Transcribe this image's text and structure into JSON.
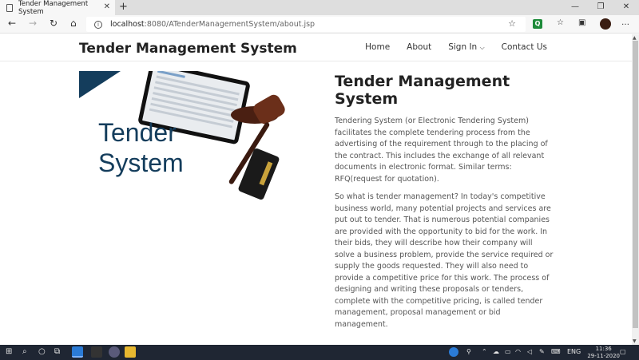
{
  "browser": {
    "tab_title": "Tender Management System",
    "url_host": "localhost",
    "url_rest": ":8080/ATenderManagementSystem/about.jsp"
  },
  "site": {
    "brand": "Tender Management System",
    "nav": [
      "Home",
      "About",
      "Sign In",
      "Contact Us"
    ]
  },
  "hero_image": {
    "caption_line1": "Tender",
    "caption_line2": "System"
  },
  "content": {
    "heading": "Tender Management System",
    "paragraph1": "Tendering System (or Electronic Tendering System) facilitates the complete tendering process from the advertising of the requirement through to the placing of the contract. This includes the exchange of all relevant documents in electronic format. Similar terms: RFQ(request for quotation).",
    "paragraph2": "So what is tender management? In today's competitive business world, many potential projects and services are put out to tender. That is numerous potential companies are provided with the opportunity to bid for the work. In their bids, they will describe how their company will solve a business problem, provide the service required or supply the goods requested. They will also need to provide a competitive price for this work. The process of designing and writing these proposals or tenders, complete with the competitive pricing, is called tender management, proposal management or bid management."
  },
  "taskbar": {
    "language": "ENG",
    "time": "11:36",
    "date": "29-11-2020"
  },
  "colors": {
    "hero_navy": "#143d5c",
    "taskbar": "#1f2633"
  },
  "icons": [
    "document-icon",
    "close-icon",
    "plus-icon",
    "back-icon",
    "forward-icon",
    "refresh-icon",
    "home-icon",
    "info-icon",
    "star-icon",
    "favorites-icon",
    "collections-icon",
    "menu-icon",
    "windows-icon",
    "search-icon",
    "chevron-down-icon"
  ]
}
